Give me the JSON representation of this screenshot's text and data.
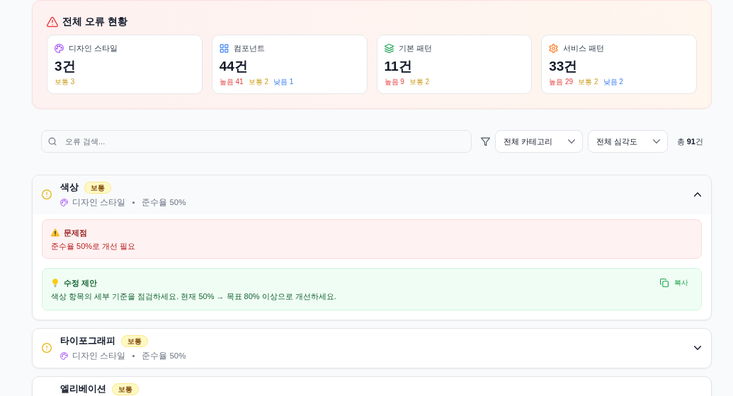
{
  "summary": {
    "title": "전체 오류 현황",
    "cards": [
      {
        "kind": "design",
        "label": "디자인 스타일",
        "count": "3건",
        "breakdown": [
          {
            "kind": "medium",
            "text": "보통 3"
          }
        ]
      },
      {
        "kind": "component",
        "label": "컴포넌트",
        "count": "44건",
        "breakdown": [
          {
            "kind": "high",
            "text": "높음 41"
          },
          {
            "kind": "medium",
            "text": "보통 2"
          },
          {
            "kind": "low",
            "text": "낮음 1"
          }
        ]
      },
      {
        "kind": "pattern",
        "label": "기본 패턴",
        "count": "11건",
        "breakdown": [
          {
            "kind": "high",
            "text": "높음 9"
          },
          {
            "kind": "medium",
            "text": "보통 2"
          }
        ]
      },
      {
        "kind": "service",
        "label": "서비스 패턴",
        "count": "33건",
        "breakdown": [
          {
            "kind": "high",
            "text": "높음 29"
          },
          {
            "kind": "medium",
            "text": "보통 2"
          },
          {
            "kind": "low",
            "text": "낮음 2"
          }
        ]
      }
    ]
  },
  "toolbar": {
    "search": {
      "placeholder": "오류 검색..."
    },
    "filters": [
      {
        "value": "전체 카테고리"
      },
      {
        "value": "전체 심각도"
      }
    ],
    "total": "총 **91**건"
  },
  "issues": [
    {
      "title": "색상",
      "badge": {
        "kind": "medium",
        "label": "보통"
      },
      "category": {
        "kind": "design",
        "label": "디자인 스타일"
      },
      "compliance": "준수율 50%",
      "expanded": true,
      "problem": {
        "title": "문제점",
        "text": "준수율 50%로 개선 필요"
      },
      "suggestion": {
        "title": "수정 제안",
        "text": "색상 항목의 세부 기준을 점검하세요. 현재 50% → 목표 80% 이상으로 개선하세요.",
        "copy_label": "복사"
      }
    },
    {
      "title": "타이포그래피",
      "badge": {
        "kind": "medium",
        "label": "보통"
      },
      "category": {
        "kind": "design",
        "label": "디자인 스타일"
      },
      "compliance": "준수율 50%",
      "expanded": false
    },
    {
      "title": "엘리베이션",
      "badge": {
        "kind": "medium",
        "label": "보통"
      }
    }
  ]
}
